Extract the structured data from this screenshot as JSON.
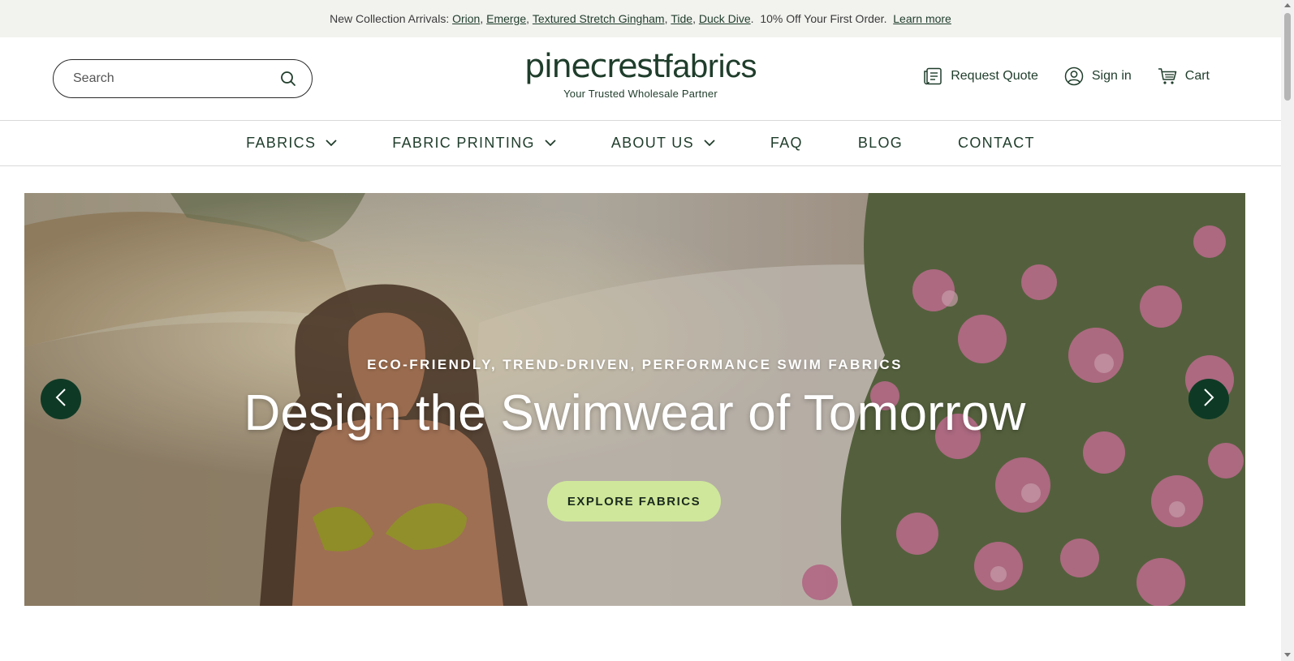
{
  "announcement": {
    "prefix": "New Collection Arrivals: ",
    "links": [
      "Orion",
      "Emerge",
      "Textured Stretch Gingham",
      "Tide",
      "Duck Dive"
    ],
    "offer": "10% Off Your First Order.",
    "learn_more": "Learn more"
  },
  "search": {
    "placeholder": "Search",
    "icon": "search-icon"
  },
  "brand": {
    "name_part1": "pinecrest",
    "name_part2": "fabrics",
    "tagline": "Your Trusted Wholesale Partner"
  },
  "header_actions": {
    "request_quote": "Request Quote",
    "sign_in": "Sign in",
    "cart": "Cart"
  },
  "nav": {
    "items": [
      {
        "label": "FABRICS",
        "has_dropdown": true
      },
      {
        "label": "FABRIC PRINTING",
        "has_dropdown": true
      },
      {
        "label": "ABOUT US",
        "has_dropdown": true
      },
      {
        "label": "FAQ",
        "has_dropdown": false
      },
      {
        "label": "BLOG",
        "has_dropdown": false
      },
      {
        "label": "CONTACT",
        "has_dropdown": false
      }
    ]
  },
  "hero": {
    "eyebrow": "ECO-FRIENDLY, TREND-DRIVEN, PERFORMANCE SWIM FABRICS",
    "headline": "Design the Swimwear of Tomorrow",
    "cta": "EXPLORE FABRICS"
  },
  "colors": {
    "brand_green": "#1f3d2b",
    "arrow_bg": "#0e3a25",
    "cta_bg": "#cfe79a",
    "announce_bg": "#f2f2ef"
  }
}
